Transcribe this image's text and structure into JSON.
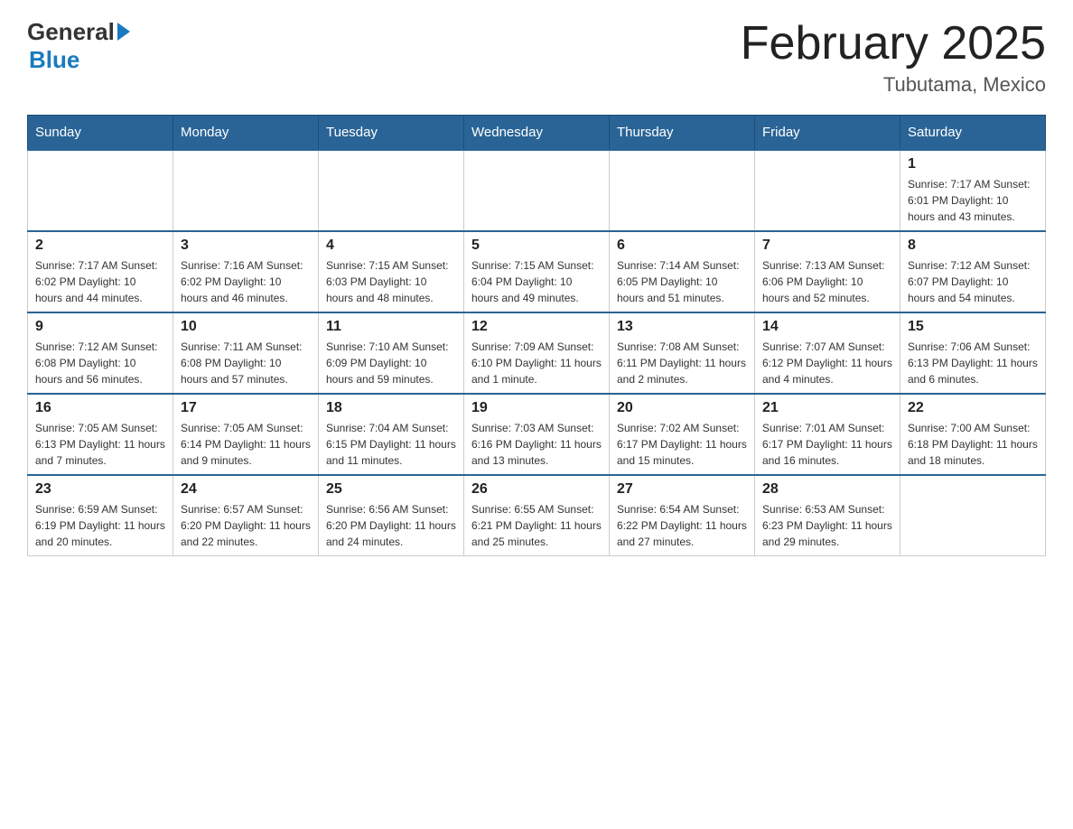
{
  "header": {
    "logo_general": "General",
    "logo_blue": "Blue",
    "month_title": "February 2025",
    "location": "Tubutama, Mexico"
  },
  "days_of_week": [
    "Sunday",
    "Monday",
    "Tuesday",
    "Wednesday",
    "Thursday",
    "Friday",
    "Saturday"
  ],
  "weeks": [
    [
      {
        "day": "",
        "info": ""
      },
      {
        "day": "",
        "info": ""
      },
      {
        "day": "",
        "info": ""
      },
      {
        "day": "",
        "info": ""
      },
      {
        "day": "",
        "info": ""
      },
      {
        "day": "",
        "info": ""
      },
      {
        "day": "1",
        "info": "Sunrise: 7:17 AM\nSunset: 6:01 PM\nDaylight: 10 hours\nand 43 minutes."
      }
    ],
    [
      {
        "day": "2",
        "info": "Sunrise: 7:17 AM\nSunset: 6:02 PM\nDaylight: 10 hours\nand 44 minutes."
      },
      {
        "day": "3",
        "info": "Sunrise: 7:16 AM\nSunset: 6:02 PM\nDaylight: 10 hours\nand 46 minutes."
      },
      {
        "day": "4",
        "info": "Sunrise: 7:15 AM\nSunset: 6:03 PM\nDaylight: 10 hours\nand 48 minutes."
      },
      {
        "day": "5",
        "info": "Sunrise: 7:15 AM\nSunset: 6:04 PM\nDaylight: 10 hours\nand 49 minutes."
      },
      {
        "day": "6",
        "info": "Sunrise: 7:14 AM\nSunset: 6:05 PM\nDaylight: 10 hours\nand 51 minutes."
      },
      {
        "day": "7",
        "info": "Sunrise: 7:13 AM\nSunset: 6:06 PM\nDaylight: 10 hours\nand 52 minutes."
      },
      {
        "day": "8",
        "info": "Sunrise: 7:12 AM\nSunset: 6:07 PM\nDaylight: 10 hours\nand 54 minutes."
      }
    ],
    [
      {
        "day": "9",
        "info": "Sunrise: 7:12 AM\nSunset: 6:08 PM\nDaylight: 10 hours\nand 56 minutes."
      },
      {
        "day": "10",
        "info": "Sunrise: 7:11 AM\nSunset: 6:08 PM\nDaylight: 10 hours\nand 57 minutes."
      },
      {
        "day": "11",
        "info": "Sunrise: 7:10 AM\nSunset: 6:09 PM\nDaylight: 10 hours\nand 59 minutes."
      },
      {
        "day": "12",
        "info": "Sunrise: 7:09 AM\nSunset: 6:10 PM\nDaylight: 11 hours\nand 1 minute."
      },
      {
        "day": "13",
        "info": "Sunrise: 7:08 AM\nSunset: 6:11 PM\nDaylight: 11 hours\nand 2 minutes."
      },
      {
        "day": "14",
        "info": "Sunrise: 7:07 AM\nSunset: 6:12 PM\nDaylight: 11 hours\nand 4 minutes."
      },
      {
        "day": "15",
        "info": "Sunrise: 7:06 AM\nSunset: 6:13 PM\nDaylight: 11 hours\nand 6 minutes."
      }
    ],
    [
      {
        "day": "16",
        "info": "Sunrise: 7:05 AM\nSunset: 6:13 PM\nDaylight: 11 hours\nand 7 minutes."
      },
      {
        "day": "17",
        "info": "Sunrise: 7:05 AM\nSunset: 6:14 PM\nDaylight: 11 hours\nand 9 minutes."
      },
      {
        "day": "18",
        "info": "Sunrise: 7:04 AM\nSunset: 6:15 PM\nDaylight: 11 hours\nand 11 minutes."
      },
      {
        "day": "19",
        "info": "Sunrise: 7:03 AM\nSunset: 6:16 PM\nDaylight: 11 hours\nand 13 minutes."
      },
      {
        "day": "20",
        "info": "Sunrise: 7:02 AM\nSunset: 6:17 PM\nDaylight: 11 hours\nand 15 minutes."
      },
      {
        "day": "21",
        "info": "Sunrise: 7:01 AM\nSunset: 6:17 PM\nDaylight: 11 hours\nand 16 minutes."
      },
      {
        "day": "22",
        "info": "Sunrise: 7:00 AM\nSunset: 6:18 PM\nDaylight: 11 hours\nand 18 minutes."
      }
    ],
    [
      {
        "day": "23",
        "info": "Sunrise: 6:59 AM\nSunset: 6:19 PM\nDaylight: 11 hours\nand 20 minutes."
      },
      {
        "day": "24",
        "info": "Sunrise: 6:57 AM\nSunset: 6:20 PM\nDaylight: 11 hours\nand 22 minutes."
      },
      {
        "day": "25",
        "info": "Sunrise: 6:56 AM\nSunset: 6:20 PM\nDaylight: 11 hours\nand 24 minutes."
      },
      {
        "day": "26",
        "info": "Sunrise: 6:55 AM\nSunset: 6:21 PM\nDaylight: 11 hours\nand 25 minutes."
      },
      {
        "day": "27",
        "info": "Sunrise: 6:54 AM\nSunset: 6:22 PM\nDaylight: 11 hours\nand 27 minutes."
      },
      {
        "day": "28",
        "info": "Sunrise: 6:53 AM\nSunset: 6:23 PM\nDaylight: 11 hours\nand 29 minutes."
      },
      {
        "day": "",
        "info": ""
      }
    ]
  ]
}
